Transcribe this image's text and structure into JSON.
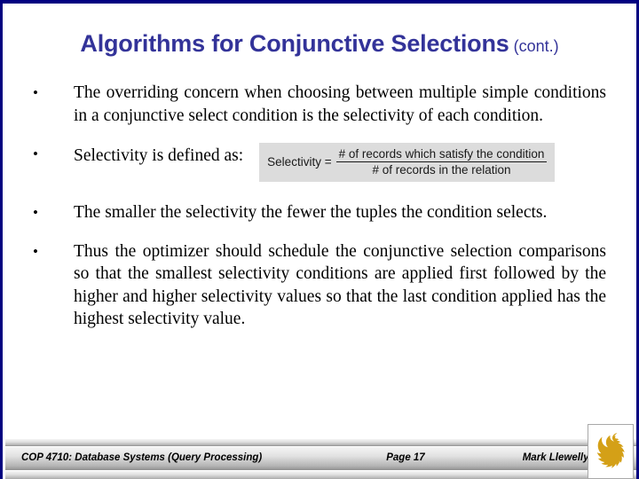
{
  "slide": {
    "title": {
      "main": "Algorithms for Conjunctive Selections",
      "suffix": "(cont.)",
      "color": "#333399"
    },
    "bullets": [
      {
        "marker": "•",
        "text": "The overriding concern when choosing between multiple simple conditions in a conjunctive select condition is the selectivity of each condition."
      },
      {
        "marker": "•",
        "text": "Selectivity is defined as:"
      },
      {
        "marker": "•",
        "text": "The smaller the selectivity the fewer the tuples the condition selects."
      },
      {
        "marker": "•",
        "text": "Thus the optimizer should schedule the conjunctive selection comparisons so that the smallest selectivity conditions are applied first followed by the higher and higher selectivity values so that the last condition applied has the highest selectivity value."
      }
    ],
    "formula": {
      "lhs": "Selectivity =",
      "numerator": "# of records which satisfy the condition",
      "denominator": "# of records in the relation",
      "background": "#dcdcdc"
    },
    "footer": {
      "course": "COP 4710: Database Systems (Query Processing)",
      "page": "Page 17",
      "author": "Mark Llewellyn ©"
    },
    "logo": {
      "name": "ucf-pegasus-logo",
      "color": "#d4a017"
    },
    "border_color": "#000080"
  }
}
